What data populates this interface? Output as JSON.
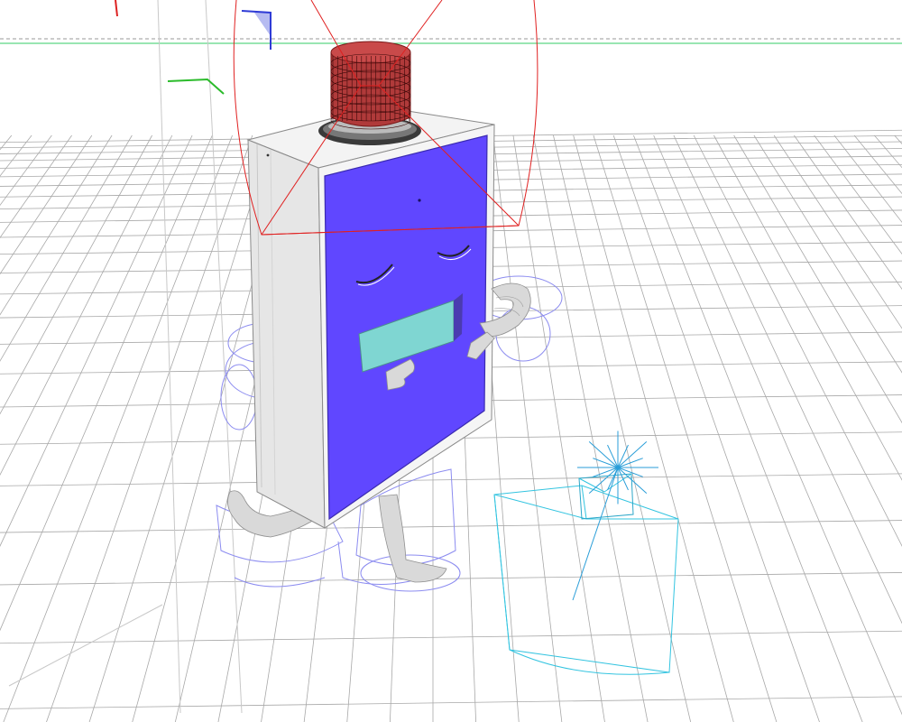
{
  "viewport": {
    "name": "3d-perspective-viewport",
    "background": "#ffffff",
    "grid_color": "#a8a8a8",
    "horizon_line_color": "#33cc66",
    "dashed_line_color": "#9a9a9a"
  },
  "character": {
    "name": "refrigerator-character",
    "body_color": "#ececec",
    "door_color": "#6047ff",
    "mouth_color": "#7fd6d2",
    "limb_color": "#d9d9d9"
  },
  "rig": {
    "ik_controls_color": "#8c8cf0",
    "head_control_color": "#e02020",
    "camera_color": "#33c4e0",
    "axis_gizmo_colors": [
      "#2f3bd6",
      "#2bbb2b",
      "#dd2222"
    ]
  }
}
